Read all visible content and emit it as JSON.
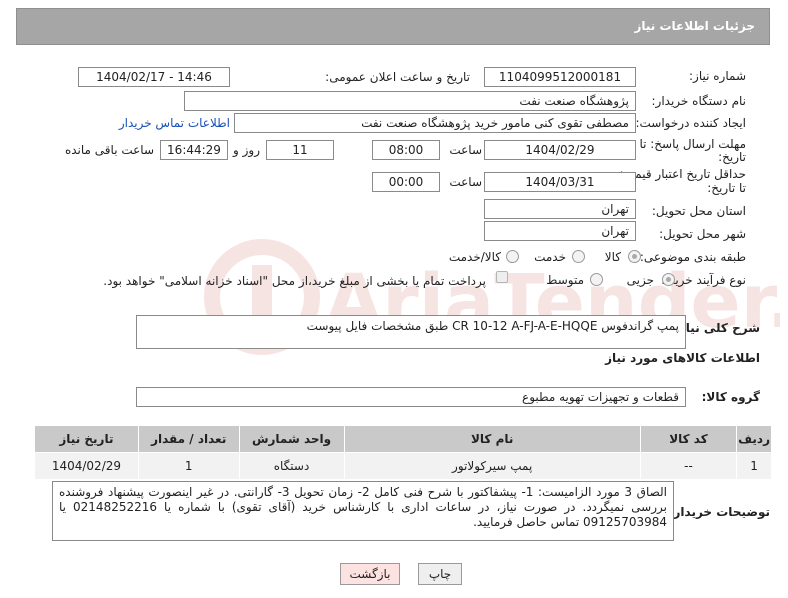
{
  "header": {
    "title": "جزئیات اطلاعات نیاز"
  },
  "form": {
    "need_number": {
      "label": "شماره نیاز:",
      "value": "1104099512000181"
    },
    "announce": {
      "label": "تاریخ و ساعت اعلان عمومی:",
      "value": "1404/02/17 - 14:46"
    },
    "buyer_org": {
      "label": "نام دستگاه خریدار:",
      "value": "پژوهشگاه صنعت نفت"
    },
    "requester": {
      "label": "ایجاد کننده درخواست:",
      "value": "مصطفی تقوی کنی مامور خرید پژوهشگاه صنعت نفت",
      "link": "اطلاعات تماس خریدار"
    },
    "deadline": {
      "label_line1": "مهلت ارسال پاسخ: تا",
      "label_line2": "تاریخ:",
      "date": "1404/02/29",
      "time_label": "ساعت",
      "time": "08:00",
      "days": "11",
      "days_label": "روز و",
      "remaining": "16:44:29",
      "remaining_label": "ساعت باقی مانده"
    },
    "validity": {
      "label_line1": "حداقل تاریخ اعتبار قیمت:",
      "label_line2": "تا تاریخ:",
      "date": "1404/03/31",
      "time_label": "ساعت",
      "time": "00:00"
    },
    "province": {
      "label": "استان محل تحویل:",
      "value": "تهران"
    },
    "city": {
      "label": "شهر محل تحویل:",
      "value": "تهران"
    },
    "category": {
      "label": "طبقه بندی موضوعی:",
      "options": [
        "کالا",
        "خدمت",
        "کالا/خدمت"
      ],
      "selected": "کالا"
    },
    "process": {
      "label": "نوع فرآیند خرید :",
      "options": [
        "جزیی",
        "متوسط"
      ],
      "selected": "جزیی",
      "payment_note": "پرداخت تمام یا بخشی از مبلغ خرید،از محل \"اسناد خزانه اسلامی\" خواهد بود."
    },
    "summary": {
      "label": "شرح کلی نیاز:",
      "value": "پمپ گراندفوس CR 10-12 A-FJ-A-E-HQQE طبق مشخصات فایل پیوست"
    }
  },
  "goods": {
    "section_title": "اطلاعات کالاهای مورد نیاز",
    "group_label": "گروه کالا:",
    "group_value": "قطعات و تجهیزات تهویه مطبوع",
    "columns": [
      "ردیف",
      "کد کالا",
      "نام کالا",
      "واحد شمارش",
      "تعداد / مقدار",
      "تاریخ نیاز"
    ],
    "rows": [
      [
        "1",
        "--",
        "پمپ سیرکولاتور",
        "دستگاه",
        "1",
        "1404/02/29"
      ]
    ]
  },
  "buyer_notes": {
    "label": "توضیحات خریدار:",
    "value": "الصاق 3 مورد الزامیست: 1- پیشفاکتور با شرح فنی کامل 2- زمان تحویل 3- گارانتی. در غیر اینصورت پیشنهاد فروشنده بررسی نمیگردد. در صورت نیاز، در ساعات اداری با کارشناس خرید (آقای تقوی) با شماره یا 02148252216 یا 09125703984 تماس حاصل فرمایید."
  },
  "buttons": {
    "print": "چاپ",
    "back": "بازگشت"
  },
  "watermark": {
    "text": "AriaTender.net"
  },
  "colors": {
    "header_bg": "#a6a6a6",
    "link": "#1a4fb8",
    "back_button_bg": "#fde2e2",
    "watermark": "#c0392b"
  }
}
